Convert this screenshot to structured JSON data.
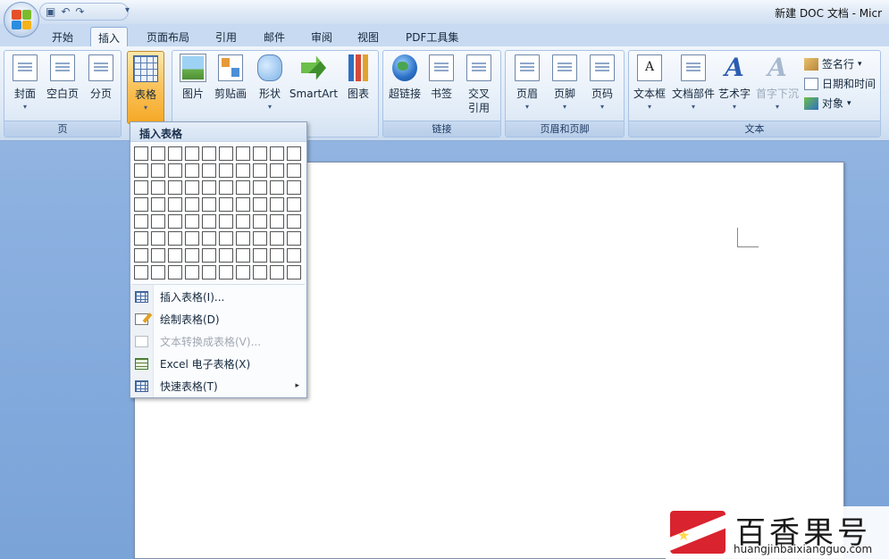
{
  "window": {
    "title": "新建 DOC 文档 - Micr"
  },
  "quick_access": {
    "save_icon": "save-icon",
    "undo_icon": "undo-icon",
    "redo_icon": "redo-icon",
    "more": "▾"
  },
  "tabs": [
    "开始",
    "插入",
    "页面布局",
    "引用",
    "邮件",
    "审阅",
    "视图",
    "PDF工具集"
  ],
  "active_tab": "插入",
  "ribbon": {
    "groups": {
      "pages": {
        "label": "页",
        "buttons": [
          "封面",
          "空白页",
          "分页"
        ]
      },
      "tables": {
        "buttons": [
          "表格"
        ]
      },
      "illustrations": {
        "buttons": [
          "图片",
          "剪贴画",
          "形状",
          "SmartArt",
          "图表"
        ]
      },
      "links": {
        "label": "链接",
        "buttons": [
          "超链接",
          "书签",
          "交叉",
          "引用"
        ]
      },
      "header_footer": {
        "label": "页眉和页脚",
        "buttons": [
          "页眉",
          "页脚",
          "页码"
        ]
      },
      "text": {
        "label": "文本",
        "buttons": [
          "文本框",
          "文档部件",
          "艺术字",
          "首字下沉"
        ],
        "small": [
          "签名行",
          "日期和时间",
          "对象"
        ]
      }
    }
  },
  "insert_table_menu": {
    "header": "插入表格",
    "grid": {
      "columns": 10,
      "rows": 8
    },
    "items": [
      {
        "label": "插入表格(I)...",
        "icon": "table-icon",
        "enabled": true
      },
      {
        "label": "绘制表格(D)",
        "icon": "pencil-icon",
        "enabled": true
      },
      {
        "label": "文本转换成表格(V)...",
        "icon": "convert-text-icon",
        "enabled": false
      },
      {
        "label": "Excel 电子表格(X)",
        "icon": "excel-icon",
        "enabled": true
      },
      {
        "label": "快速表格(T)",
        "icon": "quick-table-icon",
        "enabled": true,
        "submenu": "▸"
      }
    ]
  },
  "watermark": {
    "name": "百香果号",
    "url": "huangjinbaixiangguo.com"
  }
}
